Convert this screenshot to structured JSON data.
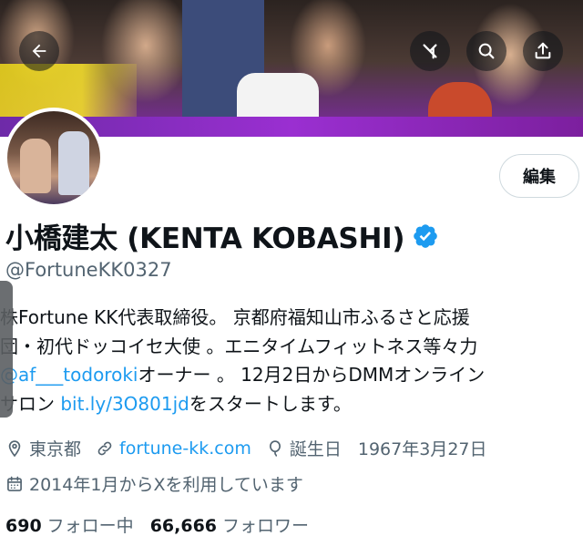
{
  "header": {
    "back_icon": "arrow-left-icon",
    "grok_icon": "grok-icon",
    "search_icon": "search-icon",
    "share_icon": "share-icon"
  },
  "profile": {
    "edit_label": "編集",
    "display_name": "小橋建太 (KENTA KOBASHI)",
    "verified_icon": "verified-badge-icon",
    "handle": "@FortuneKK0327",
    "bio": {
      "line1": "株Fortune KK代表取締役。 京都府福知山市ふるさと応援",
      "line2": "団・初代ドッコイセ大使 。エニタイムフィットネス等々力",
      "line3_link": "@af___todoroki",
      "line3_rest": "オーナー 。 12月2日からDMMオンライン",
      "line4_pre": "サロン ",
      "line4_link": "bit.ly/3O801jd",
      "line4_post": "をスタートします。"
    },
    "location": "東京都",
    "website": "fortune-kk.com",
    "birthday_label": "誕生日",
    "birthday": "1967年3月27日",
    "joined": "2014年1月からXを利用しています",
    "following_count": "690",
    "following_label": "フォロー中",
    "followers_count": "66,666",
    "followers_label": "フォロワー"
  },
  "colors": {
    "link": "#1d9bf0",
    "secondary_text": "#536471",
    "verified": "#1d9bf0"
  }
}
